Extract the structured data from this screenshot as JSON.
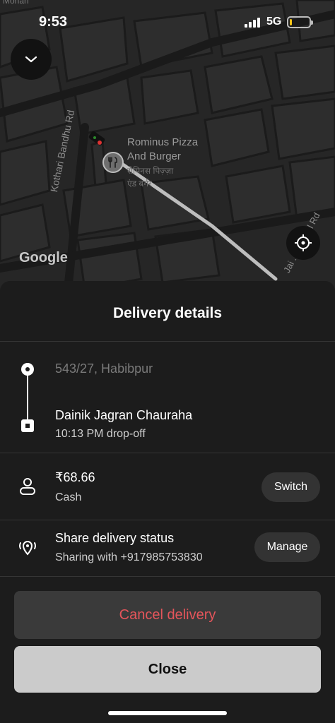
{
  "status_bar": {
    "time": "9:53",
    "network": "5G",
    "battery_level": 0.1,
    "battery_color": "#f5c518"
  },
  "map": {
    "collapse_icon": "chevron-down-icon",
    "locate_icon": "crosshair-icon",
    "poi_icon": "restaurant-fork-knife-icon",
    "poi_name_line1": "Rominus Pizza",
    "poi_name_line2": "And Burger",
    "poi_hindi_line1": "रोमिनस पिज़्ज़ा",
    "poi_hindi_line2": "एंड बर्गर",
    "road_1": "Kothari Bandhu Rd",
    "road_2": "Jai ... School Rd",
    "road_top": "Mohan",
    "attribution": "Google",
    "route_color": "#bdbdbd"
  },
  "sheet": {
    "title": "Delivery details",
    "pickup_address": "543/27, Habibpur",
    "dropoff_address": "Dainik Jagran Chauraha",
    "dropoff_time": "10:13 PM drop-off",
    "payment": {
      "icon": "person-icon",
      "amount": "₹68.66",
      "method": "Cash",
      "action": "Switch"
    },
    "share": {
      "icon": "location-share-icon",
      "title": "Share delivery status",
      "subtitle": "Sharing with +917985753830",
      "action": "Manage"
    },
    "cancel_label": "Cancel delivery",
    "cancel_color": "#e5555b",
    "close_label": "Close"
  }
}
